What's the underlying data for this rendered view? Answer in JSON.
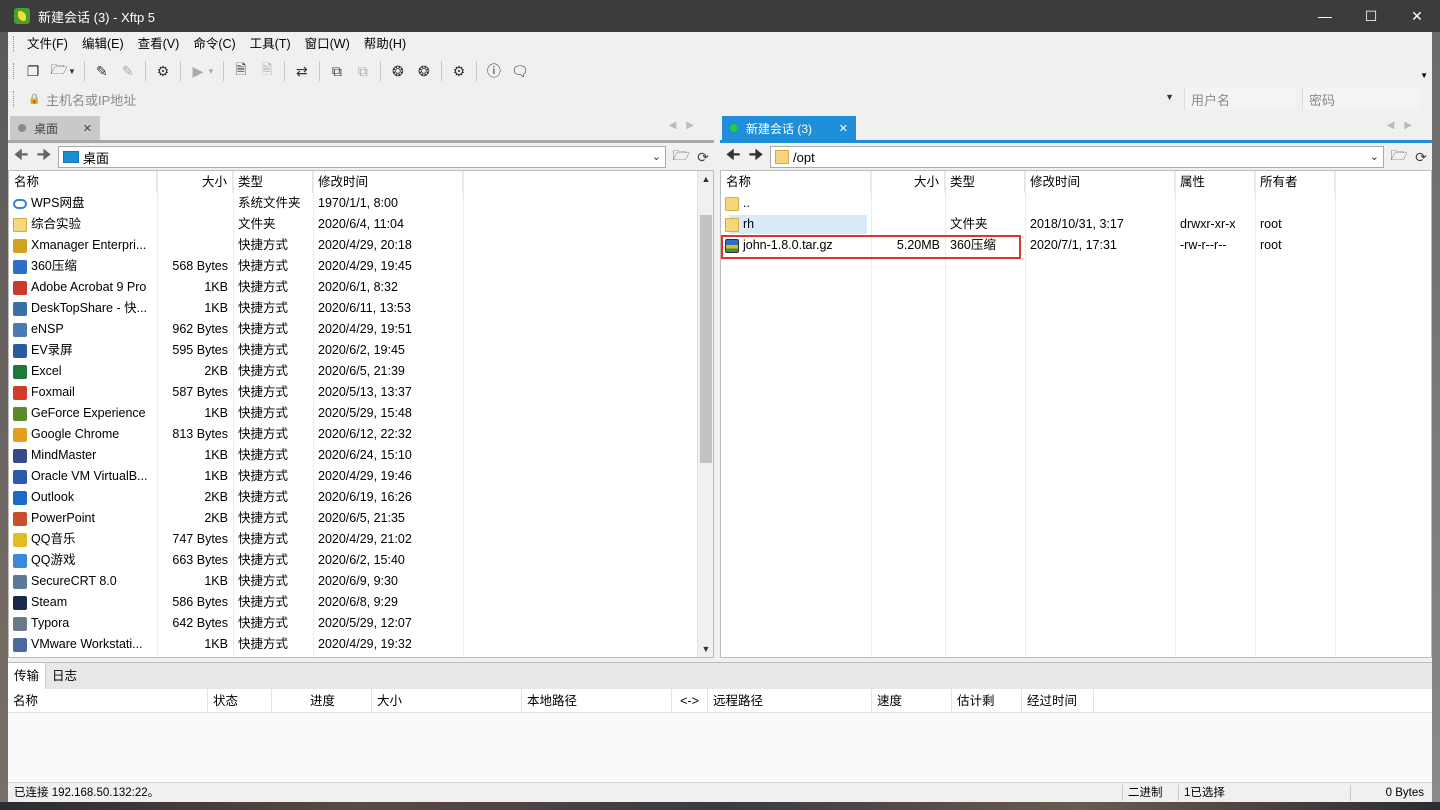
{
  "window": {
    "title": "新建会话 (3)    - Xftp 5",
    "controls": [
      "minimize",
      "maximize",
      "close"
    ]
  },
  "menu": [
    "文件(F)",
    "编辑(E)",
    "查看(V)",
    "命令(C)",
    "工具(T)",
    "窗口(W)",
    "帮助(H)"
  ],
  "address": {
    "host_placeholder": "主机名或IP地址",
    "user_placeholder": "用户名",
    "password_placeholder": "密码"
  },
  "left": {
    "tab_label": "桌面",
    "path": "桌面",
    "headers": [
      "名称",
      "大小",
      "类型",
      "修改时间"
    ],
    "rows": [
      {
        "name": "WPS网盘",
        "size": "",
        "type": "系统文件夹",
        "mtime": "1970/1/1, 8:00",
        "icon": "cloud",
        "color": "#3a7ee0"
      },
      {
        "name": "综合实验",
        "size": "",
        "type": "文件夹",
        "mtime": "2020/6/4, 11:04",
        "icon": "folder",
        "color": "#f5d67a"
      },
      {
        "name": "Xmanager Enterpri...",
        "size": "",
        "type": "快捷方式",
        "mtime": "2020/4/29, 20:18",
        "icon": "app",
        "color": "#d4a020"
      },
      {
        "name": "360压缩",
        "size": "568 Bytes",
        "type": "快捷方式",
        "mtime": "2020/4/29, 19:45",
        "icon": "app",
        "color": "#2d6ec7"
      },
      {
        "name": "Adobe Acrobat 9 Pro",
        "size": "1KB",
        "type": "快捷方式",
        "mtime": "2020/6/1, 8:32",
        "icon": "app",
        "color": "#c83a2c"
      },
      {
        "name": "DeskTopShare - 快...",
        "size": "1KB",
        "type": "快捷方式",
        "mtime": "2020/6/11, 13:53",
        "icon": "app",
        "color": "#3a6ea8"
      },
      {
        "name": "eNSP",
        "size": "962 Bytes",
        "type": "快捷方式",
        "mtime": "2020/4/29, 19:51",
        "icon": "app",
        "color": "#4a7ab0"
      },
      {
        "name": "EV录屏",
        "size": "595 Bytes",
        "type": "快捷方式",
        "mtime": "2020/6/2, 19:45",
        "icon": "app",
        "color": "#2c5aa0"
      },
      {
        "name": "Excel",
        "size": "2KB",
        "type": "快捷方式",
        "mtime": "2020/6/5, 21:39",
        "icon": "app",
        "color": "#1e7a3c"
      },
      {
        "name": "Foxmail",
        "size": "587 Bytes",
        "type": "快捷方式",
        "mtime": "2020/5/13, 13:37",
        "icon": "app",
        "color": "#d43a2a"
      },
      {
        "name": "GeForce Experience",
        "size": "1KB",
        "type": "快捷方式",
        "mtime": "2020/5/29, 15:48",
        "icon": "app",
        "color": "#5a8a2c"
      },
      {
        "name": "Google Chrome",
        "size": "813 Bytes",
        "type": "快捷方式",
        "mtime": "2020/6/12, 22:32",
        "icon": "app",
        "color": "#e0a020"
      },
      {
        "name": "MindMaster",
        "size": "1KB",
        "type": "快捷方式",
        "mtime": "2020/6/24, 15:10",
        "icon": "app",
        "color": "#3a4a8a"
      },
      {
        "name": "Oracle VM VirtualB...",
        "size": "1KB",
        "type": "快捷方式",
        "mtime": "2020/4/29, 19:46",
        "icon": "app",
        "color": "#2a5aa8"
      },
      {
        "name": "Outlook",
        "size": "2KB",
        "type": "快捷方式",
        "mtime": "2020/6/19, 16:26",
        "icon": "app",
        "color": "#1a6ac8"
      },
      {
        "name": "PowerPoint",
        "size": "2KB",
        "type": "快捷方式",
        "mtime": "2020/6/5, 21:35",
        "icon": "app",
        "color": "#c8502a"
      },
      {
        "name": "QQ音乐",
        "size": "747 Bytes",
        "type": "快捷方式",
        "mtime": "2020/4/29, 21:02",
        "icon": "app",
        "color": "#e0c020"
      },
      {
        "name": "QQ游戏",
        "size": "663 Bytes",
        "type": "快捷方式",
        "mtime": "2020/6/2, 15:40",
        "icon": "app",
        "color": "#3a8ad8"
      },
      {
        "name": "SecureCRT 8.0",
        "size": "1KB",
        "type": "快捷方式",
        "mtime": "2020/6/9, 9:30",
        "icon": "app",
        "color": "#5a7a9a"
      },
      {
        "name": "Steam",
        "size": "586 Bytes",
        "type": "快捷方式",
        "mtime": "2020/6/8, 9:29",
        "icon": "app",
        "color": "#1a2a4a"
      },
      {
        "name": "Typora",
        "size": "642 Bytes",
        "type": "快捷方式",
        "mtime": "2020/5/29, 12:07",
        "icon": "app",
        "color": "#6a7a8a"
      },
      {
        "name": "VMware Workstati...",
        "size": "1KB",
        "type": "快捷方式",
        "mtime": "2020/4/29, 19:32",
        "icon": "app",
        "color": "#4a6aa0"
      }
    ]
  },
  "right": {
    "tab_label": "新建会话 (3)",
    "path": "/opt",
    "headers": [
      "名称",
      "大小",
      "类型",
      "修改时间",
      "属性",
      "所有者"
    ],
    "rows": [
      {
        "name": "..",
        "size": "",
        "type": "",
        "mtime": "",
        "attr": "",
        "owner": "",
        "icon": "folder"
      },
      {
        "name": "rh",
        "size": "",
        "type": "文件夹",
        "mtime": "2018/10/31, 3:17",
        "attr": "drwxr-xr-x",
        "owner": "root",
        "icon": "folder"
      },
      {
        "name": "john-1.8.0.tar.gz",
        "size": "5.20MB",
        "type": "360压缩",
        "mtime": "2020/7/1, 17:31",
        "attr": "-rw-r--r--",
        "owner": "root",
        "icon": "gz"
      }
    ]
  },
  "transfer": {
    "tabs": [
      "传输",
      "日志"
    ],
    "headers": [
      "名称",
      "状态",
      "进度",
      "大小",
      "本地路径",
      "<->",
      "远程路径",
      "速度",
      "估计剩余...",
      "经过时间"
    ]
  },
  "status": {
    "connection": "已连接 192.168.50.132:22。",
    "mode": "二进制",
    "selected": "1已选择",
    "bytes": "0 Bytes"
  }
}
